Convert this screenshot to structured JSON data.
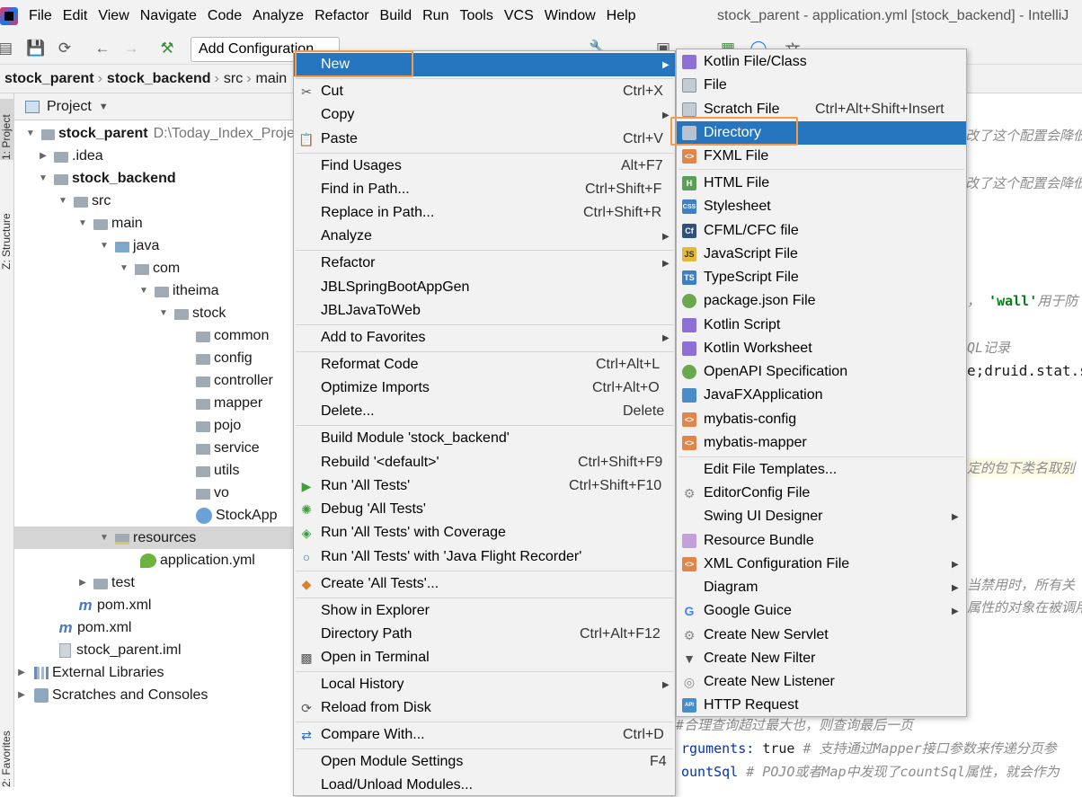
{
  "window_title": "stock_parent - application.yml [stock_backend] - IntelliJ",
  "menubar": [
    "File",
    "Edit",
    "View",
    "Navigate",
    "Code",
    "Analyze",
    "Refactor",
    "Build",
    "Run",
    "Tools",
    "VCS",
    "Window",
    "Help"
  ],
  "toolbar": {
    "add_config": "Add Configuration..."
  },
  "breadcrumb": [
    "stock_parent",
    "stock_backend",
    "src",
    "main"
  ],
  "side_tabs": {
    "project": "1: Project",
    "structure": "Z: Structure",
    "favorites": "2: Favorites"
  },
  "project_panel": {
    "title": "Project",
    "tree": [
      {
        "label": "stock_parent",
        "extra": "D:\\Today_Index_Proje"
      },
      {
        "label": ".idea"
      },
      {
        "label": "stock_backend"
      },
      {
        "label": "src"
      },
      {
        "label": "main"
      },
      {
        "label": "java"
      },
      {
        "label": "com"
      },
      {
        "label": "itheima"
      },
      {
        "label": "stock"
      },
      {
        "label": "common"
      },
      {
        "label": "config"
      },
      {
        "label": "controller"
      },
      {
        "label": "mapper"
      },
      {
        "label": "pojo"
      },
      {
        "label": "service"
      },
      {
        "label": "utils"
      },
      {
        "label": "vo"
      },
      {
        "label": "StockApp"
      },
      {
        "label": "resources"
      },
      {
        "label": "application.yml"
      },
      {
        "label": "test"
      },
      {
        "label": "pom.xml"
      },
      {
        "label": "pom.xml"
      },
      {
        "label": "stock_parent.iml"
      },
      {
        "label": "External Libraries"
      },
      {
        "label": "Scratches and Consoles"
      }
    ]
  },
  "editor": {
    "l1": "改了这个配置会降低",
    "l2": "改了这个配置会降低",
    "l3a": "，",
    "l3b": "'wall'",
    "l3c": "用于防",
    "l4": "QL记录",
    "l5": "e;druid.stat.s",
    "l6": "定的包下类名取别",
    "l7": "当禁用时，所有关",
    "l8": "属性的对象在被调用",
    "l9": "#合理查询超过最大也，则查询最后一页",
    "l10a": "rguments:",
    "l10b": "true",
    "l10c": "# 支持通过Mapper接口参数来传递分页参",
    "l11a": "ountSql",
    "l11b": "# POJO或者Map中发现了countSql属性，就会作为"
  },
  "context_menu": {
    "new": "New",
    "cut": "Cut",
    "cut_sc": "Ctrl+X",
    "copy": "Copy",
    "paste": "Paste",
    "paste_sc": "Ctrl+V",
    "find_usages": "Find Usages",
    "find_usages_sc": "Alt+F7",
    "find_in_path": "Find in Path...",
    "find_in_path_sc": "Ctrl+Shift+F",
    "replace_in_path": "Replace in Path...",
    "replace_in_path_sc": "Ctrl+Shift+R",
    "analyze": "Analyze",
    "refactor": "Refactor",
    "jbl1": "JBLSpringBootAppGen",
    "jbl2": "JBLJavaToWeb",
    "add_fav": "Add to Favorites",
    "reformat": "Reformat Code",
    "reformat_sc": "Ctrl+Alt+L",
    "optimize": "Optimize Imports",
    "optimize_sc": "Ctrl+Alt+O",
    "delete": "Delete...",
    "delete_sc": "Delete",
    "build_module": "Build Module 'stock_backend'",
    "rebuild": "Rebuild '<default>'",
    "rebuild_sc": "Ctrl+Shift+F9",
    "run_tests": "Run 'All Tests'",
    "run_tests_sc": "Ctrl+Shift+F10",
    "debug_tests": "Debug 'All Tests'",
    "run_cov": "Run 'All Tests' with Coverage",
    "run_jfr": "Run 'All Tests' with 'Java Flight Recorder'",
    "create_tests": "Create 'All Tests'...",
    "show_explorer": "Show in Explorer",
    "dir_path": "Directory Path",
    "dir_path_sc": "Ctrl+Alt+F12",
    "open_terminal": "Open in Terminal",
    "local_history": "Local History",
    "reload": "Reload from Disk",
    "compare": "Compare With...",
    "compare_sc": "Ctrl+D",
    "module_settings": "Open Module Settings",
    "module_settings_sc": "F4",
    "load_unload": "Load/Unload Modules..."
  },
  "new_submenu": {
    "kotlin_class": "Kotlin File/Class",
    "file": "File",
    "scratch": "Scratch File",
    "scratch_sc": "Ctrl+Alt+Shift+Insert",
    "directory": "Directory",
    "fxml": "FXML File",
    "html": "HTML File",
    "stylesheet": "Stylesheet",
    "cfml": "CFML/CFC file",
    "js": "JavaScript File",
    "ts": "TypeScript File",
    "pkgjson": "package.json File",
    "kts": "Kotlin Script",
    "ktw": "Kotlin Worksheet",
    "openapi": "OpenAPI Specification",
    "javafx": "JavaFXApplication",
    "mybatis_config": "mybatis-config",
    "mybatis_mapper": "mybatis-mapper",
    "edit_templates": "Edit File Templates...",
    "editorconfig": "EditorConfig File",
    "swing": "Swing UI Designer",
    "bundle": "Resource Bundle",
    "xmlconf": "XML Configuration File",
    "diagram": "Diagram",
    "guice": "Google Guice",
    "servlet": "Create New Servlet",
    "filter": "Create New Filter",
    "listener": "Create New Listener",
    "http": "HTTP Request"
  },
  "icon_text": {
    "js": "JS",
    "ts": "TS",
    "css": "CSS",
    "cf": "Cf",
    "api": "API",
    "h": "H"
  },
  "colors": {
    "highlight": "#2675bf",
    "outline": "#f39c4b"
  }
}
